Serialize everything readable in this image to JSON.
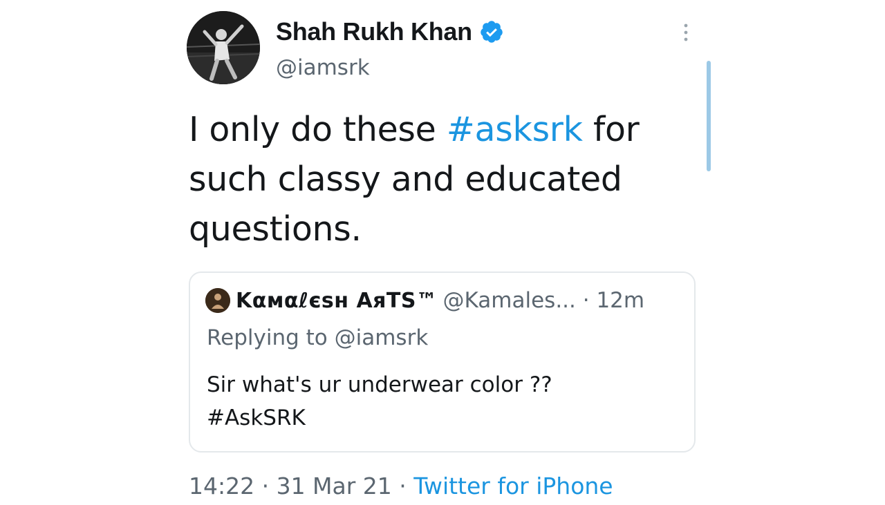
{
  "author": {
    "display_name": "Shah Rukh Khan",
    "handle": "@iamsrk",
    "verified": true,
    "avatar_icon": "profile-photo"
  },
  "tweet": {
    "text_before": "I only do these ",
    "hashtag": "#asksrk",
    "text_after": " for such classy and educated questions."
  },
  "quoted_tweet": {
    "display_name": "Kαмαℓєѕн AяTS™",
    "handle_time": "@Kamales... · 12m",
    "replying_to": "Replying to @iamsrk",
    "text_line1": "Sir what's ur underwear color ??",
    "text_line2": "#AskSRK"
  },
  "meta": {
    "time_date": "14:22 · 31 Mar 21 · ",
    "source": "Twitter for iPhone"
  },
  "colors": {
    "link": "#1b95e0",
    "verified": "#1d9bf0",
    "secondary_text": "#5b6670",
    "scroll_indicator": "#9cc9e6"
  }
}
